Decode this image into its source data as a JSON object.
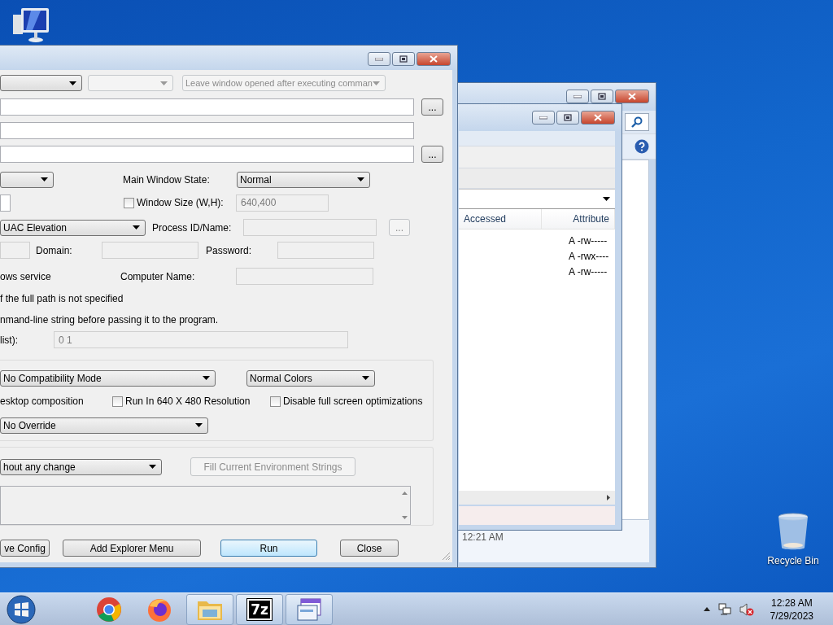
{
  "desktop_icons": [
    {
      "kind": "computer"
    },
    {
      "kind": "recycle_bin",
      "label": "Recycle Bin"
    }
  ],
  "explorer_back": {
    "status_time": "12:21 AM"
  },
  "explorer_front": {
    "columns": [
      "Accessed",
      "Attribute"
    ],
    "rows": [
      {
        "attribute": "A -rw-----"
      },
      {
        "attribute": "A -rwx----"
      },
      {
        "attribute": "A -rw-----"
      }
    ]
  },
  "dialog": {
    "top_combos": [
      {
        "disabled": false
      },
      {
        "disabled": true
      },
      {
        "value": "Leave window opened after executing comman",
        "disabled": true
      }
    ],
    "path_fields": [
      {
        "kind": "browse",
        "browse_button": "..."
      },
      {
        "kind": "plain"
      },
      {
        "kind": "browse",
        "browse_button": "..."
      }
    ],
    "main_window_state": {
      "label": "Main Window State:",
      "value": "Normal"
    },
    "window_size": {
      "label": "Window Size (W,H):",
      "checked": false,
      "value": "640,400",
      "disabled": true
    },
    "elevation": {
      "value": "UAC Elevation"
    },
    "process": {
      "label": "Process ID/Name:",
      "browse_button": "...",
      "disabled": true
    },
    "domain_label": "Domain:",
    "password_label": "Password:",
    "service_text": "ows service",
    "computer_name_label": "Computer Name:",
    "path_note": "f the full path is not specified",
    "cmdline_note": "nmand-line string before passing it to the program.",
    "affinity": {
      "label": "list):",
      "value": "0 1",
      "disabled": true
    },
    "compatibility": {
      "mode": "No Compatibility Mode",
      "colors": "Normal Colors",
      "desktop_text": "esktop composition",
      "options": [
        {
          "label": "Run In 640 X 480 Resolution",
          "checked": false
        },
        {
          "label": "Disable full screen optimizations",
          "checked": false
        }
      ],
      "dpi": "No Override"
    },
    "environment": {
      "mode": "hout any change",
      "fill_button": {
        "label": "Fill Current Environment Strings",
        "disabled": true
      }
    },
    "buttons": [
      {
        "label": "ve Config",
        "default": false
      },
      {
        "label": "Add Explorer Menu",
        "default": false
      },
      {
        "label": "Run",
        "default": true
      },
      {
        "label": "Close",
        "default": false
      }
    ]
  },
  "taskbar": {
    "apps": [
      {
        "kind": "chrome",
        "running": false
      },
      {
        "kind": "firefox",
        "running": false
      },
      {
        "kind": "explorer",
        "running": true
      },
      {
        "kind": "sevenzip",
        "running": true,
        "label": "7z"
      },
      {
        "kind": "app",
        "running": true
      }
    ],
    "clock": {
      "time": "12:28 AM",
      "date": "7/29/2023"
    }
  }
}
